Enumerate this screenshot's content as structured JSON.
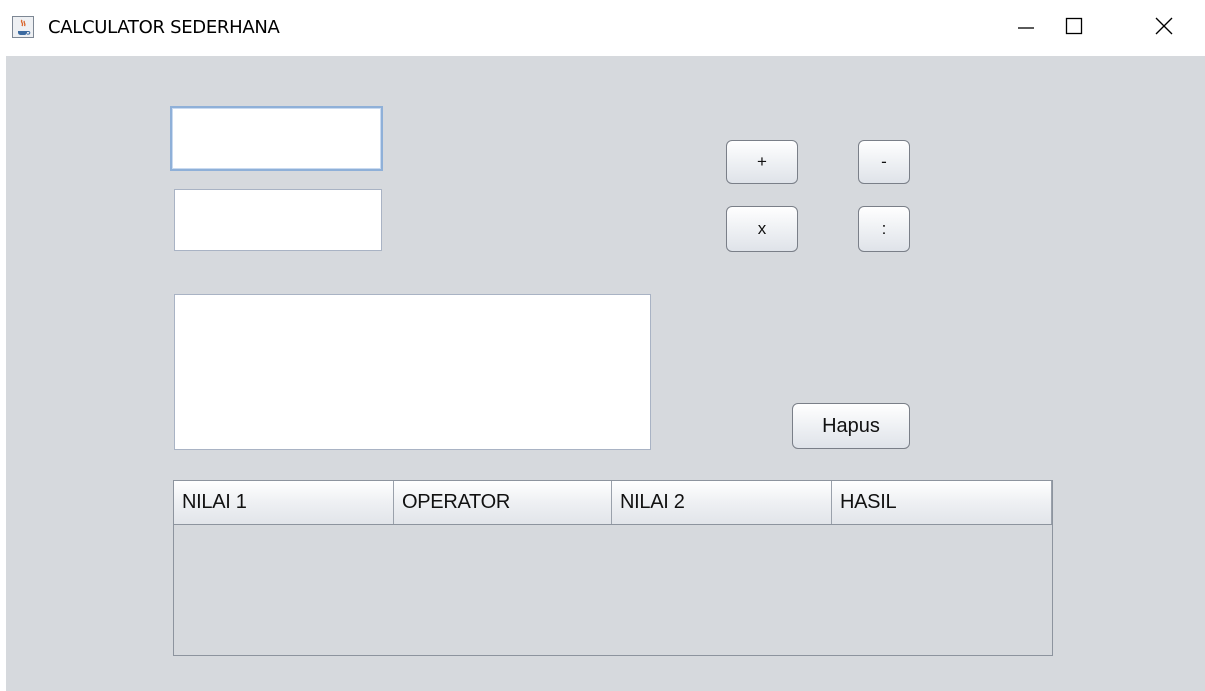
{
  "window": {
    "title": "CALCULATOR SEDERHANA"
  },
  "inputs": {
    "nilai1_value": "",
    "nilai2_value": "",
    "result_value": ""
  },
  "operators": {
    "add_label": "+",
    "subtract_label": "-",
    "multiply_label": "x",
    "divide_label": ":"
  },
  "actions": {
    "clear_label": "Hapus"
  },
  "table": {
    "columns": [
      "NILAI 1",
      "OPERATOR",
      "NILAI 2",
      "HASIL"
    ],
    "rows": []
  },
  "icons": {
    "app": "java-coffee-icon",
    "minimize": "minimize-icon",
    "maximize": "maximize-icon",
    "close": "close-icon"
  }
}
